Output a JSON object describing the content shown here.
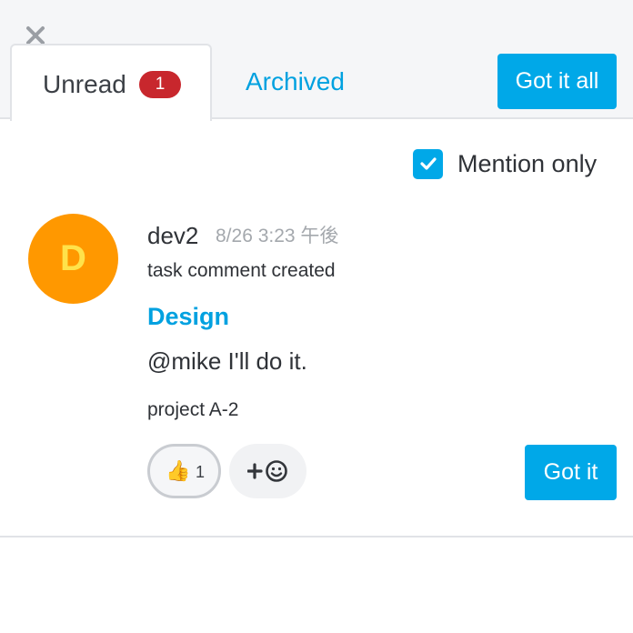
{
  "tabs": {
    "unread_label": "Unread",
    "unread_count": "1",
    "archived_label": "Archived"
  },
  "header": {
    "got_it_all_label": "Got it all"
  },
  "filter": {
    "mention_only_label": "Mention only",
    "mention_only_checked": true
  },
  "notifications": [
    {
      "avatar_initial": "D",
      "avatar_color": "#ff9800",
      "author": "dev2",
      "timestamp": "8/26 3:23 午後",
      "action": "task comment created",
      "task_title": "Design",
      "comment": "@mike I'll do it.",
      "project": "project A-2",
      "reactions": [
        {
          "emoji": "👍",
          "emoji_name": "thumbs-up",
          "count": "1"
        }
      ],
      "add_reaction_icon": "add-emoji-icon",
      "got_it_label": "Got it"
    }
  ],
  "colors": {
    "accent": "#00a8e8",
    "link": "#00a1e0",
    "badge": "#c8272d"
  }
}
